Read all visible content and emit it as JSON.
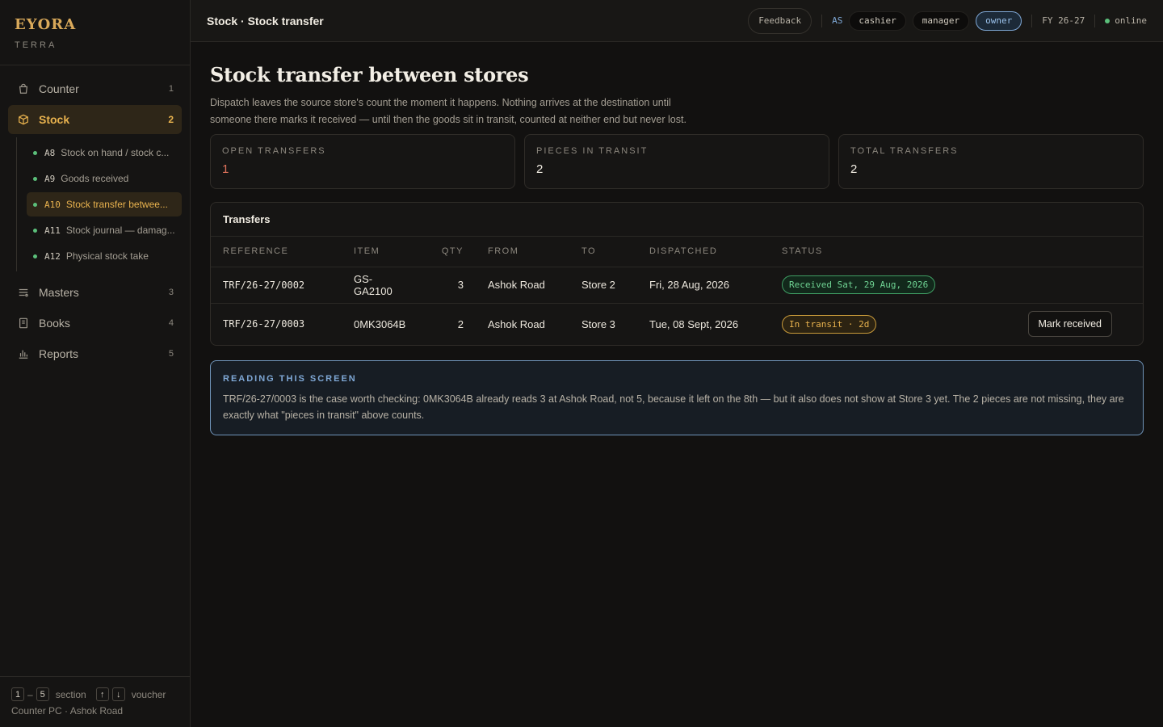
{
  "brand": {
    "name": "EYORA",
    "sub": "TERRA"
  },
  "sidebar": {
    "items": [
      {
        "label": "Counter",
        "num": "1",
        "icon": "shopping-bag-icon"
      },
      {
        "label": "Stock",
        "num": "2",
        "icon": "box-icon"
      },
      {
        "label": "Masters",
        "num": "3",
        "icon": "list-filter-icon"
      },
      {
        "label": "Books",
        "num": "4",
        "icon": "book-icon"
      },
      {
        "label": "Reports",
        "num": "5",
        "icon": "bar-chart-icon"
      }
    ],
    "subitems": [
      {
        "code": "A8",
        "label": "Stock on hand / stock c..."
      },
      {
        "code": "A9",
        "label": "Goods received"
      },
      {
        "code": "A10",
        "label": "Stock transfer betwee..."
      },
      {
        "code": "A11",
        "label": "Stock journal — damag..."
      },
      {
        "code": "A12",
        "label": "Physical stock take"
      }
    ],
    "footer": {
      "key_from": "1",
      "key_dash": "–",
      "key_to": "5",
      "section_word": "section",
      "key_up": "↑",
      "key_down": "↓",
      "voucher_word": "voucher",
      "location": "Counter PC · Ashok Road"
    }
  },
  "topbar": {
    "breadcrumb": "Stock · Stock transfer",
    "feedback": "Feedback",
    "as_label": "AS",
    "roles": [
      "cashier",
      "manager",
      "owner"
    ],
    "selected_role": "owner",
    "fy": "FY 26-27",
    "status": "online"
  },
  "page": {
    "title": "Stock transfer between stores",
    "description": "Dispatch leaves the source store's count the moment it happens. Nothing arrives at the destination until someone there marks it received — until then the goods sit in transit, counted at neither end but never lost."
  },
  "kpis": [
    {
      "label": "OPEN TRANSFERS",
      "value": "1"
    },
    {
      "label": "PIECES IN TRANSIT",
      "value": "2"
    },
    {
      "label": "TOTAL TRANSFERS",
      "value": "2"
    }
  ],
  "transfers": {
    "title": "Transfers",
    "columns": [
      "REFERENCE",
      "ITEM",
      "QTY",
      "FROM",
      "TO",
      "DISPATCHED",
      "STATUS"
    ],
    "rows": [
      {
        "ref": "TRF/26-27/0002",
        "item": "GS-GA2100",
        "qty": "3",
        "from": "Ashok Road",
        "to": "Store 2",
        "dispatched": "Fri, 28 Aug, 2026",
        "status": "Received Sat, 29 Aug, 2026",
        "action": ""
      },
      {
        "ref": "TRF/26-27/0003",
        "item": "0MK3064B",
        "qty": "2",
        "from": "Ashok Road",
        "to": "Store 3",
        "dispatched": "Tue, 08 Sept, 2026",
        "status": "In transit · 2d",
        "action": "Mark received"
      }
    ]
  },
  "note": {
    "title": "READING THIS SCREEN",
    "text": "TRF/26-27/0003 is the case worth checking: 0MK3064B already reads 3 at Ashok Road, not 5, because it left on the 8th — but it also does not show at Store 3 yet. The 2 pieces are not missing, they are exactly what \"pieces in transit\" above counts."
  },
  "colors": {
    "accent": "#e8b24e",
    "ok": "#6fd393",
    "info": "#7fa8d6",
    "alert": "#e0735c"
  }
}
